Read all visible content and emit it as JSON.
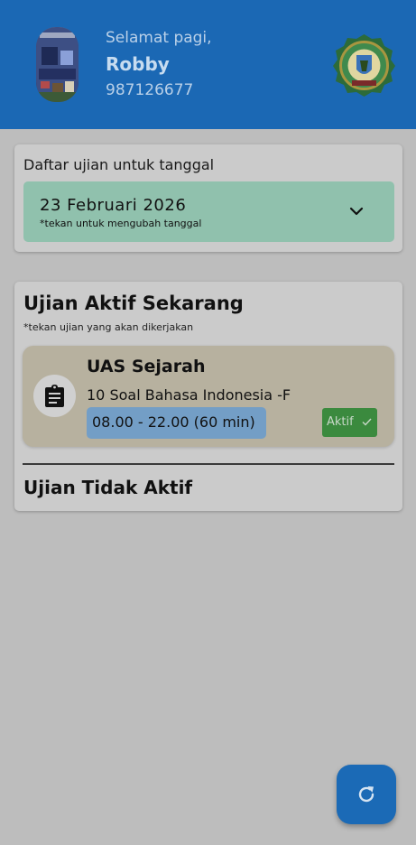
{
  "header": {
    "greeting": "Selamat pagi,",
    "user_name": "Robby",
    "user_id": "987126677"
  },
  "date_card": {
    "label": "Daftar ujian untuk tanggal",
    "selected_date": "23 Februari 2026",
    "hint": "*tekan untuk mengubah tanggal"
  },
  "active_section": {
    "title": "Ujian Aktif Sekarang",
    "hint": "*tekan ujian yang akan dikerjakan",
    "exams": [
      {
        "title": "UAS Sejarah",
        "subtitle": "10 Soal Bahasa Indonesia -F",
        "time": "08.00 - 22.00 (60 min)",
        "status": "Aktif",
        "icon": "clipboard-icon"
      }
    ]
  },
  "inactive_section": {
    "title": "Ujian Tidak Aktif"
  },
  "fab": {
    "icon": "refresh-icon"
  },
  "colors": {
    "header_bg": "#1b68b4",
    "date_box": "#90c1ad",
    "exam_card": "#b7b19f",
    "time_chip": "#739ec6",
    "status_badge": "#3b8a3e",
    "fab_bg": "#1b6ab6"
  }
}
